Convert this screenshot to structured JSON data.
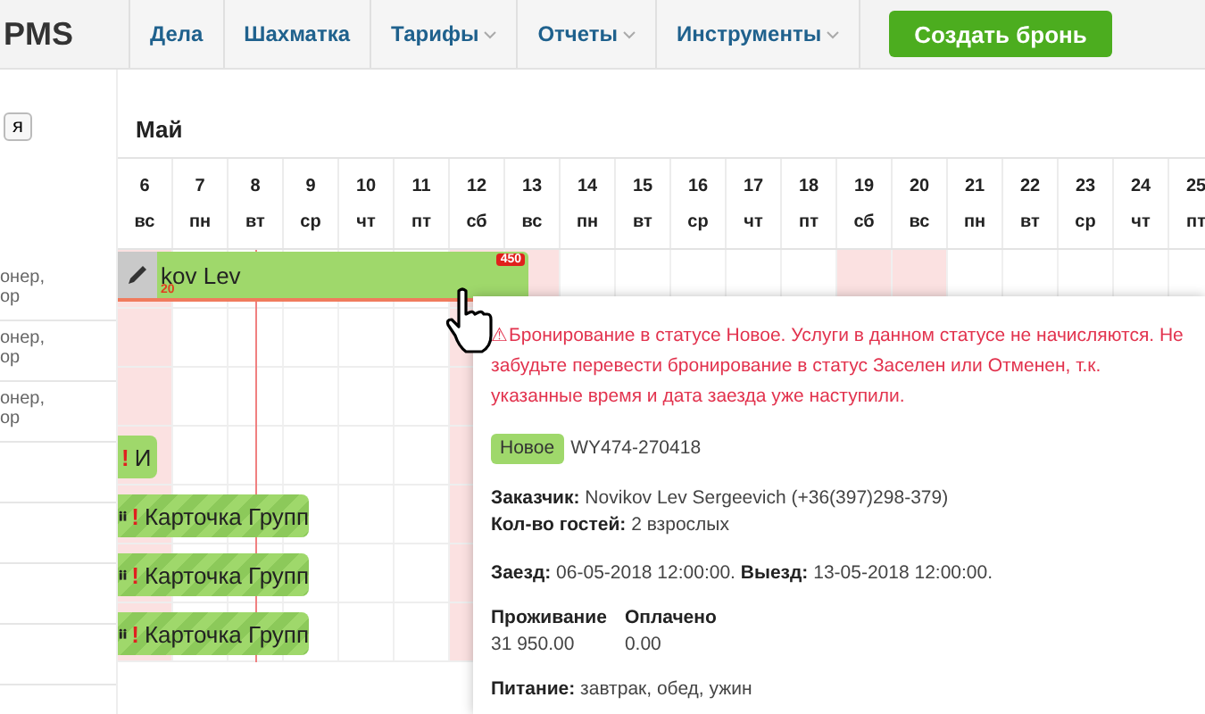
{
  "nav": {
    "logo": "PMS",
    "items": [
      {
        "label": "Дела",
        "dropdown": false
      },
      {
        "label": "Шахматка",
        "dropdown": false
      },
      {
        "label": "Тарифы",
        "dropdown": true
      },
      {
        "label": "Отчеты",
        "dropdown": true
      },
      {
        "label": "Инструменты",
        "dropdown": true
      }
    ],
    "create_button": "Создать бронь"
  },
  "sidebar": {
    "button": "я"
  },
  "calendar": {
    "month": "Май",
    "days": [
      {
        "date": "6",
        "weekday": "вс",
        "weekend": true,
        "today": false
      },
      {
        "date": "7",
        "weekday": "пн",
        "weekend": false,
        "today": false
      },
      {
        "date": "8",
        "weekday": "вт",
        "weekend": false,
        "today": true
      },
      {
        "date": "9",
        "weekday": "ср",
        "weekend": false,
        "today": false
      },
      {
        "date": "10",
        "weekday": "чт",
        "weekend": false,
        "today": false
      },
      {
        "date": "11",
        "weekday": "пт",
        "weekend": false,
        "today": false
      },
      {
        "date": "12",
        "weekday": "сб",
        "weekend": true,
        "today": false
      },
      {
        "date": "13",
        "weekday": "вс",
        "weekend": true,
        "today": false
      },
      {
        "date": "14",
        "weekday": "пн",
        "weekend": false,
        "today": false
      },
      {
        "date": "15",
        "weekday": "вт",
        "weekend": false,
        "today": false
      },
      {
        "date": "16",
        "weekday": "ср",
        "weekend": false,
        "today": false
      },
      {
        "date": "17",
        "weekday": "чт",
        "weekend": false,
        "today": false
      },
      {
        "date": "18",
        "weekday": "пт",
        "weekend": false,
        "today": false
      },
      {
        "date": "19",
        "weekday": "сб",
        "weekend": true,
        "today": false
      },
      {
        "date": "20",
        "weekday": "вс",
        "weekend": true,
        "today": false
      },
      {
        "date": "21",
        "weekday": "пн",
        "weekend": false,
        "today": false
      },
      {
        "date": "22",
        "weekday": "вт",
        "weekend": false,
        "today": false
      },
      {
        "date": "23",
        "weekday": "ср",
        "weekend": false,
        "today": false
      },
      {
        "date": "24",
        "weekday": "чт",
        "weekend": false,
        "today": false
      },
      {
        "date": "25",
        "weekday": "пт",
        "weekend": false,
        "today": false
      }
    ],
    "rows": [
      {
        "room": [
          "онер,",
          "ор"
        ],
        "booking": {
          "kind": "single",
          "label": "kov Lev",
          "note": "20",
          "badge": "450"
        }
      },
      {
        "room": [
          "онер,",
          "ор"
        ]
      },
      {
        "room": [
          "онер,",
          "ор"
        ]
      },
      {
        "booking": {
          "kind": "short",
          "alert_mark": "!",
          "label": "И"
        }
      },
      {
        "booking": {
          "kind": "group",
          "alert_mark": "!",
          "label": "Карточка Групп"
        }
      },
      {
        "booking": {
          "kind": "group",
          "alert_mark": "!",
          "label": "Карточка Групп"
        }
      },
      {
        "booking": {
          "kind": "group",
          "alert_mark": "!",
          "label": "Карточка Групп"
        }
      }
    ]
  },
  "popup": {
    "warning": "⚠Бронирование в статусе Новое. Услуги в данном статусе не начисляются. Не забудьте перевести бронирование в статус Заселен или Отменен, т.к. указанные время и дата заезда уже наступили.",
    "status": "Новое",
    "code": "WY474-270418",
    "customer": "**Заказчик:** Novikov Lev Sergeevich (+36(397)298-379)",
    "guests": "**Кол-во гостей:** 2 взрослых",
    "dates": "**Заезд:** 06-05-2018 12:00:00. **Выезд:** 13-05-2018 12:00:00.",
    "amounts": [
      {
        "label": "Проживание",
        "value": "31 950.00"
      },
      {
        "label": "Оплачено",
        "value": "0.00"
      }
    ],
    "meals": "**Питание:** завтрак, обед, ужин"
  }
}
